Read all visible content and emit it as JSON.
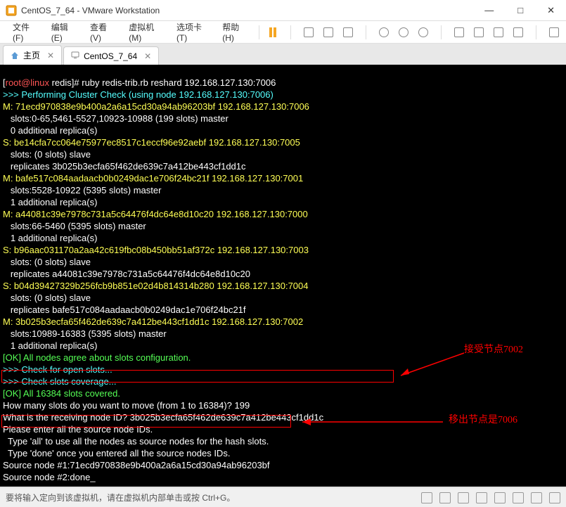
{
  "window": {
    "title": "CentOS_7_64 - VMware Workstation"
  },
  "menu": {
    "file": "文件(F)",
    "edit": "编辑(E)",
    "view": "查看(V)",
    "vm": "虚拟机(M)",
    "tabs": "选项卡(T)",
    "help": "帮助(H)"
  },
  "tabs": {
    "home": "主页",
    "vm_tab": "CentOS_7_64"
  },
  "terminal": {
    "prompt_user": "root@linux",
    "prompt_path": "redis",
    "command": "ruby redis-trib.rb reshard 192.168.127.130:7006",
    "lines": [
      ">>> Performing Cluster Check (using node 192.168.127.130:7006)",
      "M: 71ecd970838e9b400a2a6a15cd30a94ab96203bf 192.168.127.130:7006",
      "   slots:0-65,5461-5527,10923-10988 (199 slots) master",
      "   0 additional replica(s)",
      "S: be14cfa7cc064e75977ec8517c1eccf96e92aebf 192.168.127.130:7005",
      "   slots: (0 slots) slave",
      "   replicates 3b025b3ecfa65f462de639c7a412be443cf1dd1c",
      "M: bafe517c084aadaacb0b0249dac1e706f24bc21f 192.168.127.130:7001",
      "   slots:5528-10922 (5395 slots) master",
      "   1 additional replica(s)",
      "M: a44081c39e7978c731a5c64476f4dc64e8d10c20 192.168.127.130:7000",
      "   slots:66-5460 (5395 slots) master",
      "   1 additional replica(s)",
      "S: b96aac031170a2aa42c619fbc08b450bb51af372c 192.168.127.130:7003",
      "   slots: (0 slots) slave",
      "   replicates a44081c39e7978c731a5c64476f4dc64e8d10c20",
      "S: b04d39427329b256fcb9b851e02d4b814314b280 192.168.127.130:7004",
      "   slots: (0 slots) slave",
      "   replicates bafe517c084aadaacb0b0249dac1e706f24bc21f",
      "M: 3b025b3ecfa65f462de639c7a412be443cf1dd1c 192.168.127.130:7002",
      "   slots:10989-16383 (5395 slots) master",
      "   1 additional replica(s)",
      "[OK] All nodes agree about slots configuration.",
      ">>> Check for open slots...",
      ">>> Check slots coverage...",
      "[OK] All 16384 slots covered.",
      "How many slots do you want to move (from 1 to 16384)? 199",
      "What is the receiving node ID? 3b025b3ecfa65f462de639c7a412be443cf1dd1c",
      "Please enter all the source node IDs.",
      "  Type 'all' to use all the nodes as source nodes for the hash slots.",
      "  Type 'done' once you entered all the source nodes IDs.",
      "Source node #1:71ecd970838e9b400a2a6a15cd30a94ab96203bf",
      "Source node #2:done_"
    ]
  },
  "annotations": {
    "receive_node": "接受节点7002",
    "remove_node": "移出节点是7006"
  },
  "statusbar": {
    "text": "要将输入定向到该虚拟机，请在虚拟机内部单击或按 Ctrl+G。"
  }
}
